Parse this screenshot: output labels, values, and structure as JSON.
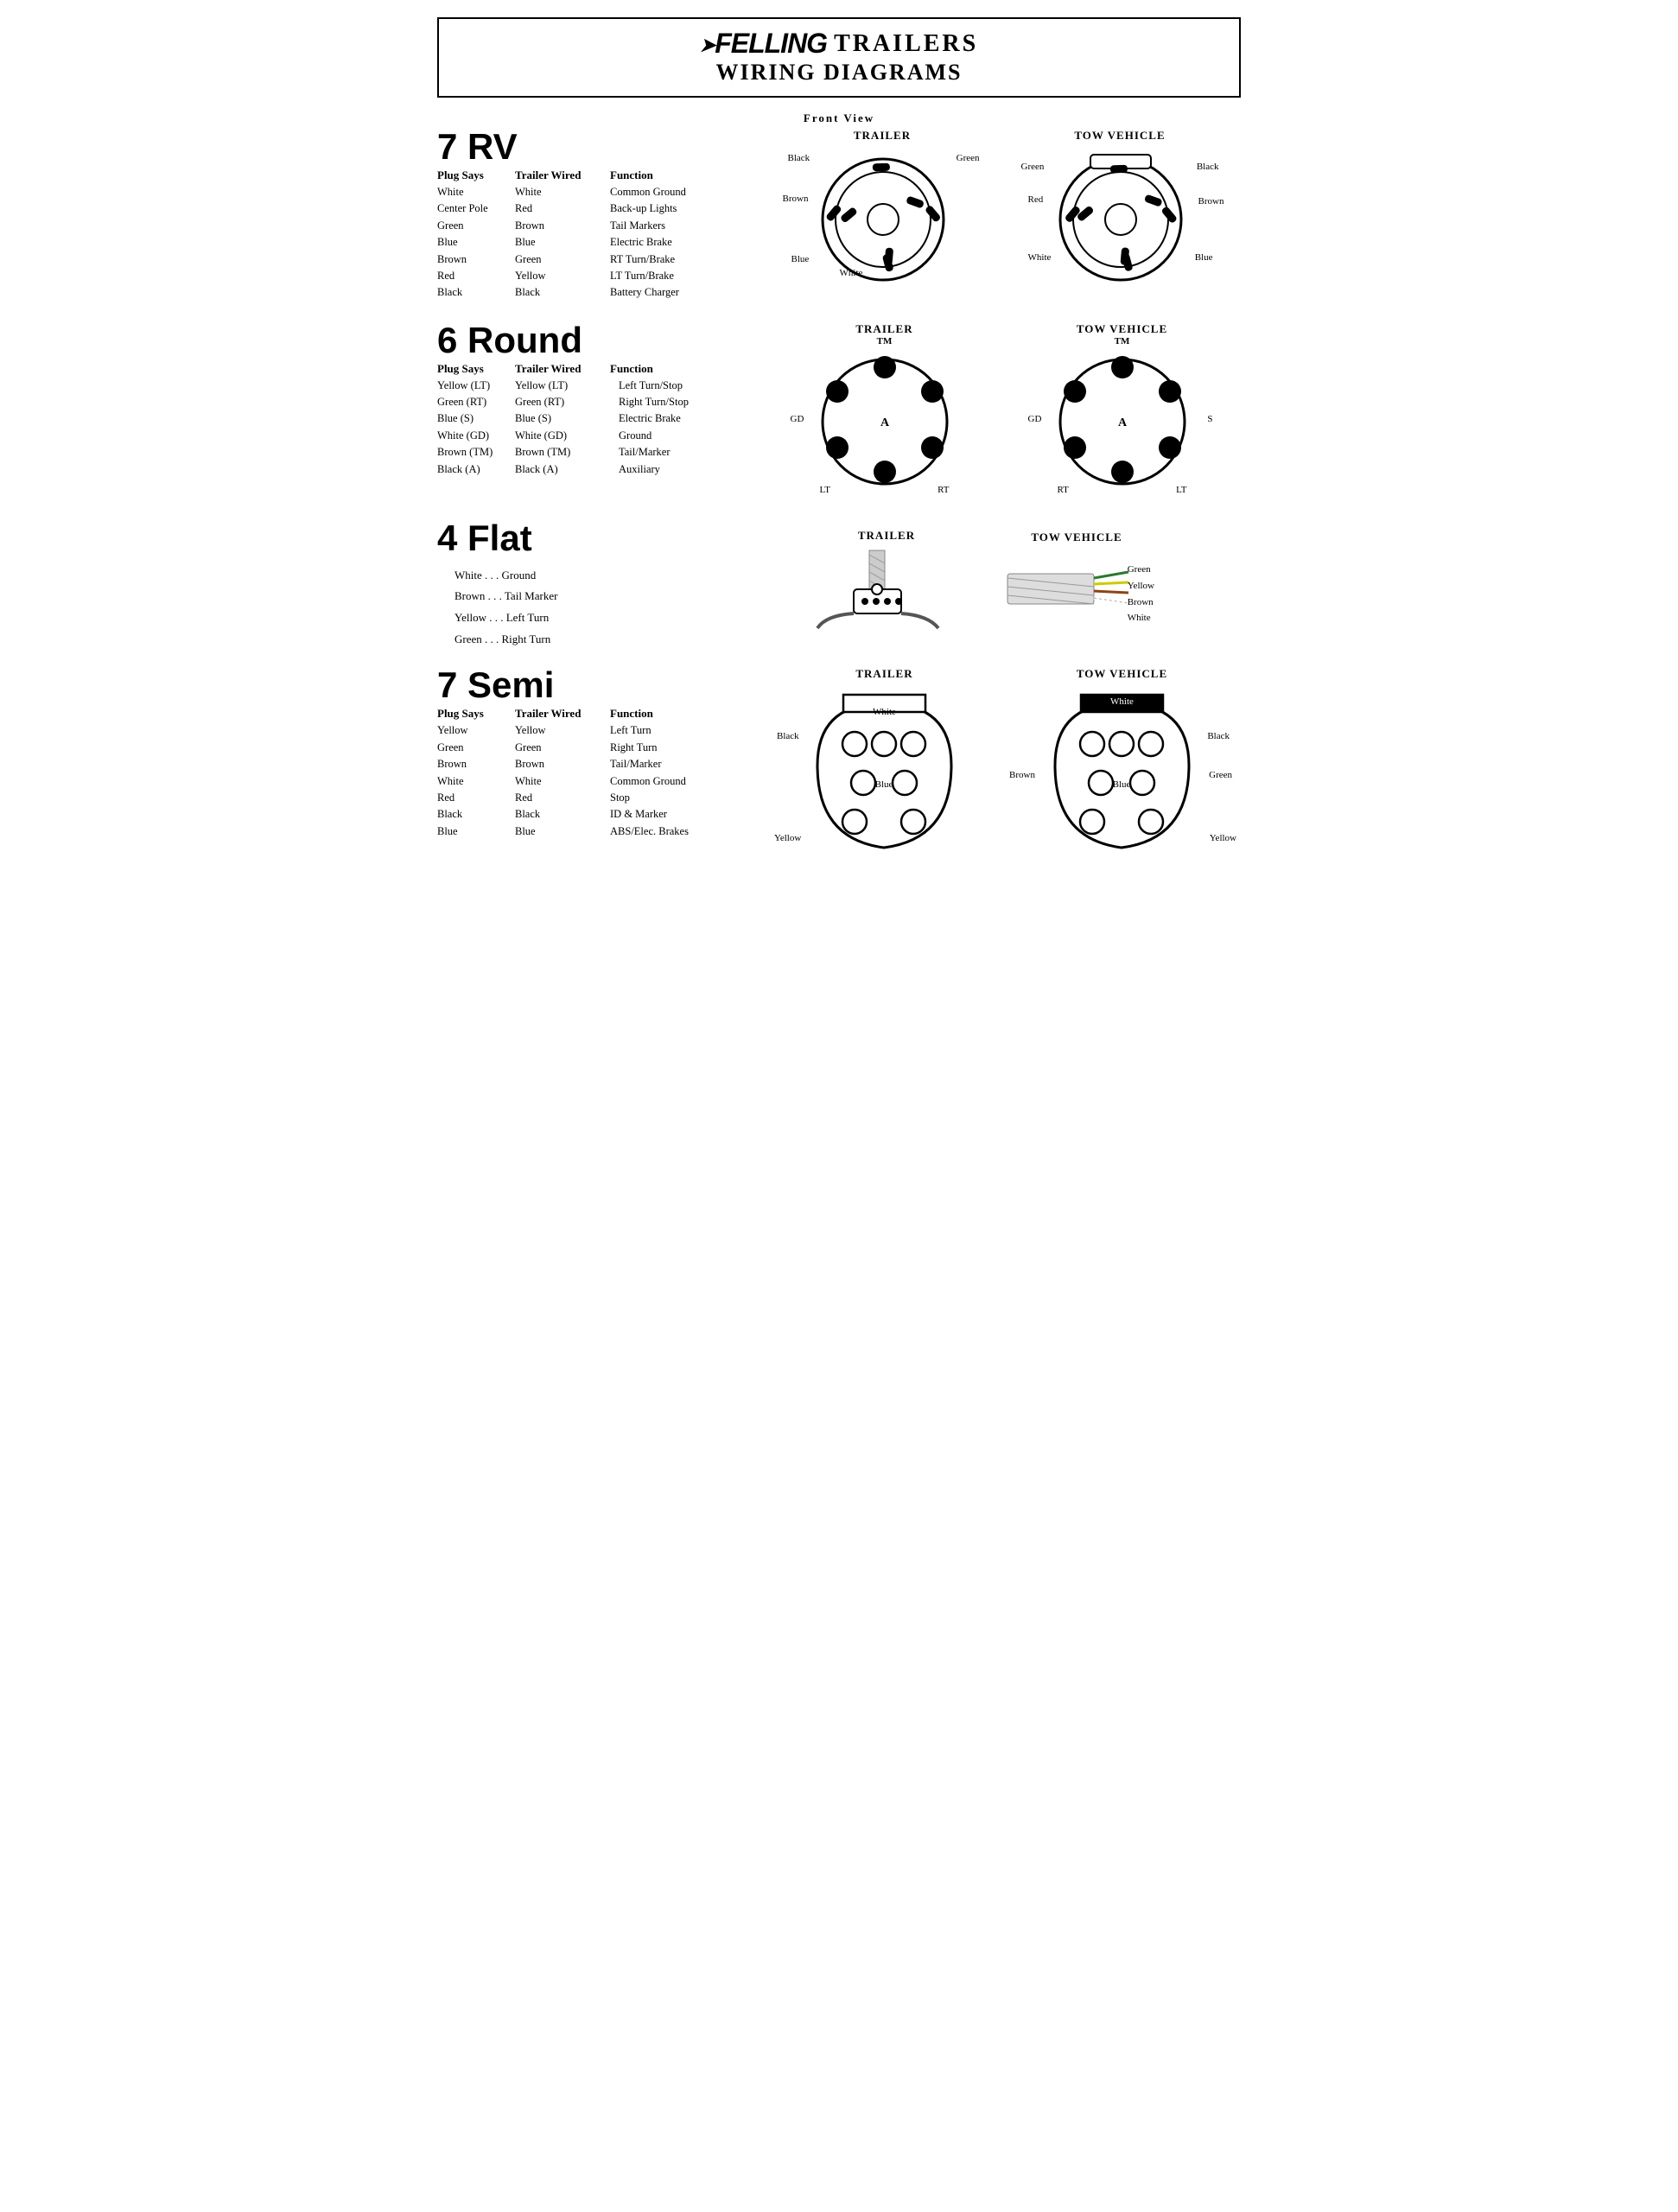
{
  "header": {
    "brand": "Felling",
    "subtitle1": "Trailers",
    "subtitle2": "Wiring Diagrams",
    "front_view": "Front View"
  },
  "rv7": {
    "heading": "7 RV",
    "col1": "Plug Says",
    "col2": "Trailer Wired",
    "col3": "Function",
    "rows": [
      [
        "White",
        "White",
        "Common Ground"
      ],
      [
        "Center Pole",
        "Red",
        "Back-up Lights"
      ],
      [
        "Green",
        "Brown",
        "Tail Markers"
      ],
      [
        "Blue",
        "Blue",
        "Electric Brake"
      ],
      [
        "Brown",
        "Green",
        "RT Turn/Brake"
      ],
      [
        "Red",
        "Yellow",
        "LT Turn/Brake"
      ],
      [
        "Black",
        "Black",
        "Battery Charger"
      ]
    ],
    "trailer_label": "TRAILER",
    "tow_label": "TOW VEHICLE"
  },
  "round6": {
    "heading": "6 Round",
    "col1": "Plug Says",
    "col2": "Trailer Wired",
    "col3": "Function",
    "rows": [
      [
        "Yellow (LT)",
        "Yellow (LT)",
        "Left Turn/Stop"
      ],
      [
        "Green (RT)",
        "Green (RT)",
        "Right Turn/Stop"
      ],
      [
        "Blue (S)",
        "Blue (S)",
        "Electric Brake"
      ],
      [
        "White (GD)",
        "White (GD)",
        "Ground"
      ],
      [
        "Brown (TM)",
        "Brown (TM)",
        "Tail/Marker"
      ],
      [
        "Black (A)",
        "Black (A)",
        "Auxiliary"
      ]
    ],
    "trailer_label": "TRAILER",
    "tow_label": "TOW VEHICLE"
  },
  "flat4": {
    "heading": "4 Flat",
    "items": [
      "White . . . Ground",
      "Brown . . . Tail Marker",
      "Yellow . . . Left Turn",
      "Green . . . Right Turn"
    ],
    "trailer_label": "TRAILER",
    "tow_label": "TOW VEHICLE",
    "wire_labels": [
      "Green",
      "Yellow",
      "Brown",
      "White"
    ]
  },
  "semi7": {
    "heading": "7 Semi",
    "col1": "Plug Says",
    "col2": "Trailer Wired",
    "col3": "Function",
    "rows": [
      [
        "Yellow",
        "Yellow",
        "Left Turn"
      ],
      [
        "Green",
        "Green",
        "Right Turn"
      ],
      [
        "Brown",
        "Brown",
        "Tail/Marker"
      ],
      [
        "White",
        "White",
        "Common Ground"
      ],
      [
        "Red",
        "Red",
        "Stop"
      ],
      [
        "Black",
        "Black",
        "ID & Marker"
      ],
      [
        "Blue",
        "Blue",
        "ABS/Elec. Brakes"
      ]
    ],
    "trailer_label": "TRAILER",
    "tow_label": "TOW VEHICLE"
  }
}
